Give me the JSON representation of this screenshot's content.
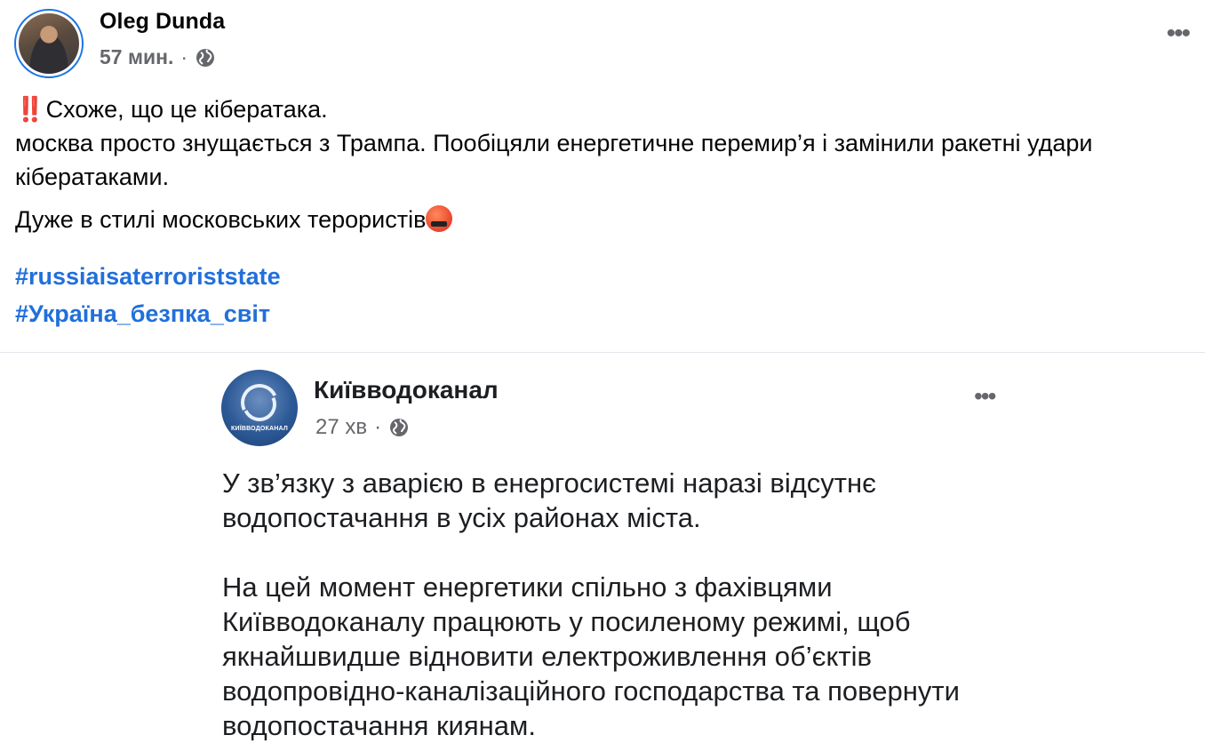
{
  "post": {
    "author": "Oleg Dunda",
    "time": "57 мин.",
    "separator": "·",
    "lines": {
      "alert_emoji": "‼️",
      "line1": "Схоже, що це кібератака.",
      "line2": "москва просто знущається з Трампа. Пообіцяли енергетичне перемир’я і замінили ракетні удари кібератаками.",
      "line3": "Дуже в стилі московських терористів"
    },
    "hashtags": [
      "#russiaisaterroriststate",
      "#Україна_безпка_світ"
    ]
  },
  "shared": {
    "page_name": "Київводоканал",
    "logo_caption": "КИЇВВОДОКАНАЛ",
    "time": "27 хв",
    "separator": "·",
    "paragraph1": "У зв’язку з аварією в енергосистемі наразі відсутнє водопостачання в усіх районах міста.",
    "paragraph2": "На цей момент енергетики спільно з фахівцями Київводоканалу працюють у посиленому режимі, щоб якнайшвидше відновити електроживлення об’єктів водопровідно-каналізаційного господарства та повернути водопостачання киянам."
  },
  "icons": {
    "globe": "globe-icon",
    "more": "more-options-icon",
    "angry": "angry-face-icon"
  },
  "colors": {
    "link": "#216fdb",
    "meta": "#65676b",
    "avatar_ring": "#1b74e4"
  }
}
